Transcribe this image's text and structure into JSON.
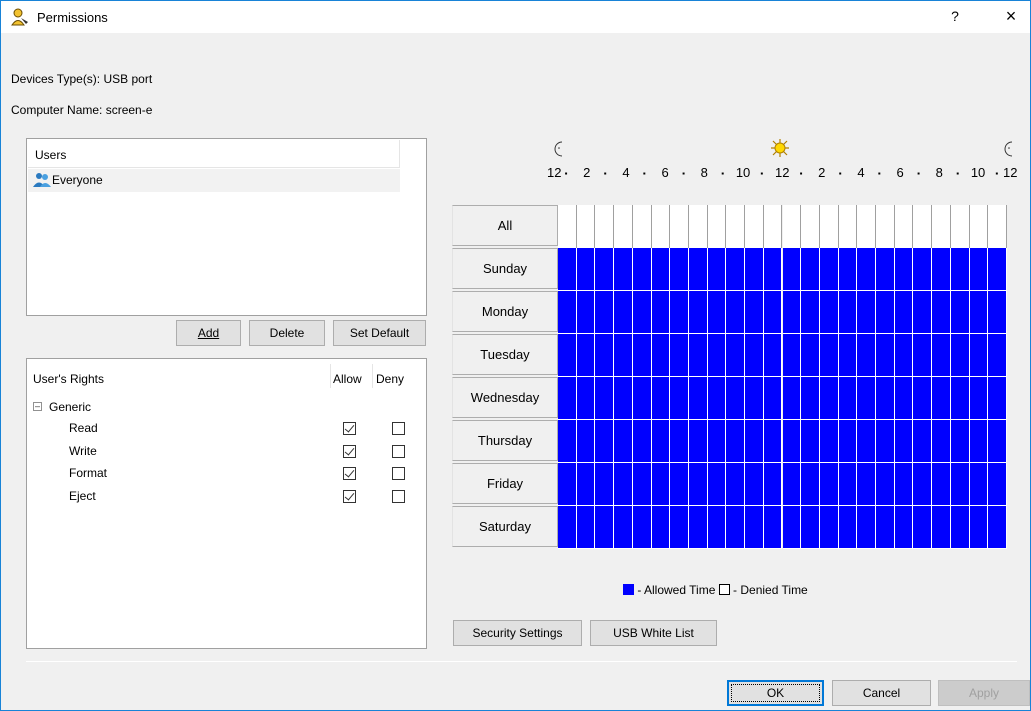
{
  "window": {
    "title": "Permissions",
    "help_label": "?",
    "close_label": "×"
  },
  "info": {
    "device_types": "Devices Type(s): USB port",
    "computer_name": "Computer Name: screen-e"
  },
  "users": {
    "header": "Users",
    "items": [
      {
        "name": "Everyone",
        "icon": "user-group-icon"
      }
    ]
  },
  "user_buttons": {
    "add": "Add",
    "delete": "Delete",
    "set_default": "Set Default"
  },
  "rights": {
    "header": "User's Rights",
    "allow_header": "Allow",
    "deny_header": "Deny",
    "group": "Generic",
    "items": [
      {
        "label": "Read",
        "allow": true,
        "deny": false
      },
      {
        "label": "Write",
        "allow": true,
        "deny": false
      },
      {
        "label": "Format",
        "allow": true,
        "deny": false
      },
      {
        "label": "Eject",
        "allow": true,
        "deny": false
      }
    ]
  },
  "schedule": {
    "hour_labels": [
      "12",
      "2",
      "4",
      "6",
      "8",
      "10",
      "12",
      "2",
      "4",
      "6",
      "8",
      "10",
      "12"
    ],
    "icons": [
      "moon-icon",
      "sun-icon",
      "moon-icon"
    ],
    "all_label": "All",
    "days": [
      "Sunday",
      "Monday",
      "Tuesday",
      "Wednesday",
      "Thursday",
      "Friday",
      "Saturday"
    ],
    "hours_per_day": 24,
    "allowed": "all",
    "allowed_color": "#0000ff",
    "denied_color": "#ffffff"
  },
  "legend": {
    "allowed": " - Allowed Time ",
    "denied": " - Denied Time"
  },
  "lower_buttons": {
    "security_settings": "Security Settings",
    "usb_white_list": "USB White List"
  },
  "dialog_buttons": {
    "ok": "OK",
    "cancel": "Cancel",
    "apply": "Apply"
  }
}
